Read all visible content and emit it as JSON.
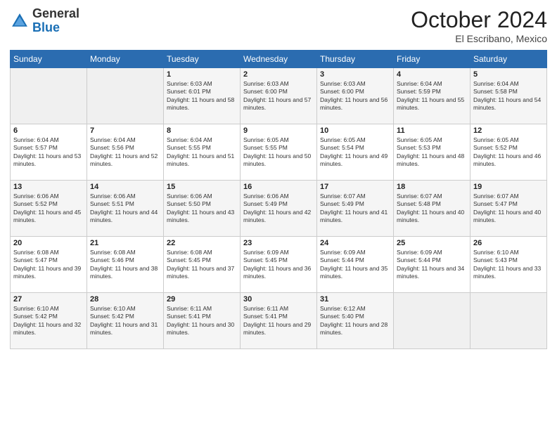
{
  "header": {
    "logo_general": "General",
    "logo_blue": "Blue",
    "month": "October 2024",
    "location": "El Escribano, Mexico"
  },
  "days_of_week": [
    "Sunday",
    "Monday",
    "Tuesday",
    "Wednesday",
    "Thursday",
    "Friday",
    "Saturday"
  ],
  "weeks": [
    [
      {
        "day": "",
        "info": ""
      },
      {
        "day": "",
        "info": ""
      },
      {
        "day": "1",
        "info": "Sunrise: 6:03 AM\nSunset: 6:01 PM\nDaylight: 11 hours and 58 minutes."
      },
      {
        "day": "2",
        "info": "Sunrise: 6:03 AM\nSunset: 6:00 PM\nDaylight: 11 hours and 57 minutes."
      },
      {
        "day": "3",
        "info": "Sunrise: 6:03 AM\nSunset: 6:00 PM\nDaylight: 11 hours and 56 minutes."
      },
      {
        "day": "4",
        "info": "Sunrise: 6:04 AM\nSunset: 5:59 PM\nDaylight: 11 hours and 55 minutes."
      },
      {
        "day": "5",
        "info": "Sunrise: 6:04 AM\nSunset: 5:58 PM\nDaylight: 11 hours and 54 minutes."
      }
    ],
    [
      {
        "day": "6",
        "info": "Sunrise: 6:04 AM\nSunset: 5:57 PM\nDaylight: 11 hours and 53 minutes."
      },
      {
        "day": "7",
        "info": "Sunrise: 6:04 AM\nSunset: 5:56 PM\nDaylight: 11 hours and 52 minutes."
      },
      {
        "day": "8",
        "info": "Sunrise: 6:04 AM\nSunset: 5:55 PM\nDaylight: 11 hours and 51 minutes."
      },
      {
        "day": "9",
        "info": "Sunrise: 6:05 AM\nSunset: 5:55 PM\nDaylight: 11 hours and 50 minutes."
      },
      {
        "day": "10",
        "info": "Sunrise: 6:05 AM\nSunset: 5:54 PM\nDaylight: 11 hours and 49 minutes."
      },
      {
        "day": "11",
        "info": "Sunrise: 6:05 AM\nSunset: 5:53 PM\nDaylight: 11 hours and 48 minutes."
      },
      {
        "day": "12",
        "info": "Sunrise: 6:05 AM\nSunset: 5:52 PM\nDaylight: 11 hours and 46 minutes."
      }
    ],
    [
      {
        "day": "13",
        "info": "Sunrise: 6:06 AM\nSunset: 5:52 PM\nDaylight: 11 hours and 45 minutes."
      },
      {
        "day": "14",
        "info": "Sunrise: 6:06 AM\nSunset: 5:51 PM\nDaylight: 11 hours and 44 minutes."
      },
      {
        "day": "15",
        "info": "Sunrise: 6:06 AM\nSunset: 5:50 PM\nDaylight: 11 hours and 43 minutes."
      },
      {
        "day": "16",
        "info": "Sunrise: 6:06 AM\nSunset: 5:49 PM\nDaylight: 11 hours and 42 minutes."
      },
      {
        "day": "17",
        "info": "Sunrise: 6:07 AM\nSunset: 5:49 PM\nDaylight: 11 hours and 41 minutes."
      },
      {
        "day": "18",
        "info": "Sunrise: 6:07 AM\nSunset: 5:48 PM\nDaylight: 11 hours and 40 minutes."
      },
      {
        "day": "19",
        "info": "Sunrise: 6:07 AM\nSunset: 5:47 PM\nDaylight: 11 hours and 40 minutes."
      }
    ],
    [
      {
        "day": "20",
        "info": "Sunrise: 6:08 AM\nSunset: 5:47 PM\nDaylight: 11 hours and 39 minutes."
      },
      {
        "day": "21",
        "info": "Sunrise: 6:08 AM\nSunset: 5:46 PM\nDaylight: 11 hours and 38 minutes."
      },
      {
        "day": "22",
        "info": "Sunrise: 6:08 AM\nSunset: 5:45 PM\nDaylight: 11 hours and 37 minutes."
      },
      {
        "day": "23",
        "info": "Sunrise: 6:09 AM\nSunset: 5:45 PM\nDaylight: 11 hours and 36 minutes."
      },
      {
        "day": "24",
        "info": "Sunrise: 6:09 AM\nSunset: 5:44 PM\nDaylight: 11 hours and 35 minutes."
      },
      {
        "day": "25",
        "info": "Sunrise: 6:09 AM\nSunset: 5:44 PM\nDaylight: 11 hours and 34 minutes."
      },
      {
        "day": "26",
        "info": "Sunrise: 6:10 AM\nSunset: 5:43 PM\nDaylight: 11 hours and 33 minutes."
      }
    ],
    [
      {
        "day": "27",
        "info": "Sunrise: 6:10 AM\nSunset: 5:42 PM\nDaylight: 11 hours and 32 minutes."
      },
      {
        "day": "28",
        "info": "Sunrise: 6:10 AM\nSunset: 5:42 PM\nDaylight: 11 hours and 31 minutes."
      },
      {
        "day": "29",
        "info": "Sunrise: 6:11 AM\nSunset: 5:41 PM\nDaylight: 11 hours and 30 minutes."
      },
      {
        "day": "30",
        "info": "Sunrise: 6:11 AM\nSunset: 5:41 PM\nDaylight: 11 hours and 29 minutes."
      },
      {
        "day": "31",
        "info": "Sunrise: 6:12 AM\nSunset: 5:40 PM\nDaylight: 11 hours and 28 minutes."
      },
      {
        "day": "",
        "info": ""
      },
      {
        "day": "",
        "info": ""
      }
    ]
  ]
}
